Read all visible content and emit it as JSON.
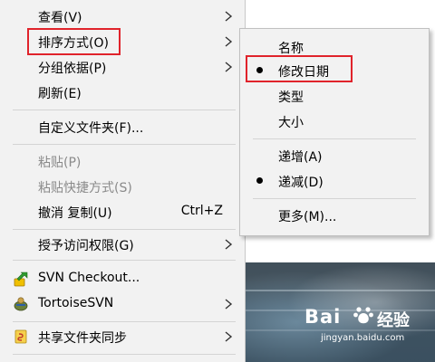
{
  "main_menu": {
    "items": [
      {
        "label": "查看(V)"
      },
      {
        "label": "排序方式(O)"
      },
      {
        "label": "分组依据(P)"
      },
      {
        "label": "刷新(E)"
      },
      {
        "label": "自定义文件夹(F)..."
      },
      {
        "label": "粘贴(P)"
      },
      {
        "label": "粘贴快捷方式(S)"
      },
      {
        "label": "撤消 复制(U)",
        "shortcut": "Ctrl+Z"
      },
      {
        "label": "授予访问权限(G)"
      },
      {
        "label": "SVN Checkout..."
      },
      {
        "label": "TortoiseSVN"
      },
      {
        "label": "共享文件夹同步"
      }
    ]
  },
  "sort_submenu": {
    "items": [
      {
        "label": "名称"
      },
      {
        "label": "修改日期",
        "selected": true
      },
      {
        "label": "类型"
      },
      {
        "label": "大小"
      },
      {
        "label": "递增(A)"
      },
      {
        "label": "递减(D)",
        "selected": true
      },
      {
        "label": "更多(M)..."
      }
    ]
  },
  "watermark": {
    "logo": "Bai",
    "logo_suffix": "经验",
    "url": "jingyan.baidu.com"
  },
  "colors": {
    "menu_bg": "#f2f2f2",
    "highlight_border": "#e0232b",
    "disabled_text": "#8a8a8a"
  }
}
